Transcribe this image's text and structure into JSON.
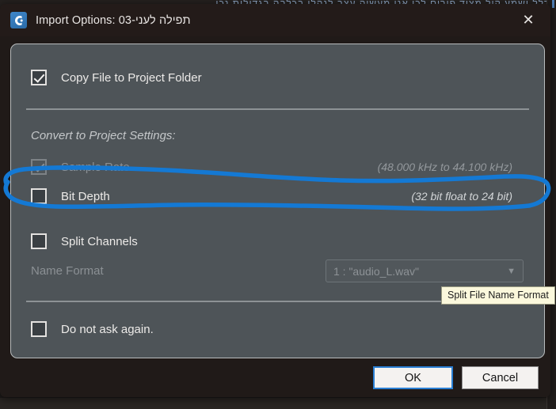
{
  "background": {
    "top_text": "כלל ושמע קול מצוד פורים לכן אנו מעשיה   עצב לנהלו   בכלבה בגדולות   נכו",
    "right_edge_label": ""
  },
  "window": {
    "icon": "app-logo-icon",
    "title": "Import Options: תפילה לעני-03",
    "close_label": "✕"
  },
  "options": {
    "copy_file": {
      "label": "Copy File to Project Folder",
      "checked": true,
      "enabled": true
    },
    "section_header": "Convert to Project Settings:",
    "sample_rate": {
      "label": "Sample Rate",
      "value": "(48.000 kHz to 44.100 kHz)",
      "checked": true,
      "enabled": false
    },
    "bit_depth": {
      "label": "Bit Depth",
      "value": "(32 bit float to 24 bit)",
      "checked": false,
      "enabled": true
    },
    "split_channels": {
      "label": "Split Channels",
      "checked": false,
      "enabled": true
    },
    "name_format": {
      "label": "Name Format",
      "value": "1 : \"audio_L.wav\"",
      "caret": "▼",
      "enabled": false
    },
    "do_not_ask": {
      "label": "Do not ask again.",
      "checked": false,
      "enabled": true
    }
  },
  "tooltip": {
    "text": "Split File Name Format"
  },
  "footer": {
    "ok_label": "OK",
    "cancel_label": "Cancel"
  },
  "annotation": {
    "description": "hand-drawn blue lasso around Bit Depth row",
    "color": "#1479D4"
  },
  "colors": {
    "panel_bg": "#4E5458",
    "titlebar_bg": "#231B19",
    "accent_blue": "#2A7FD4",
    "tooltip_bg": "#FBF8DC"
  }
}
